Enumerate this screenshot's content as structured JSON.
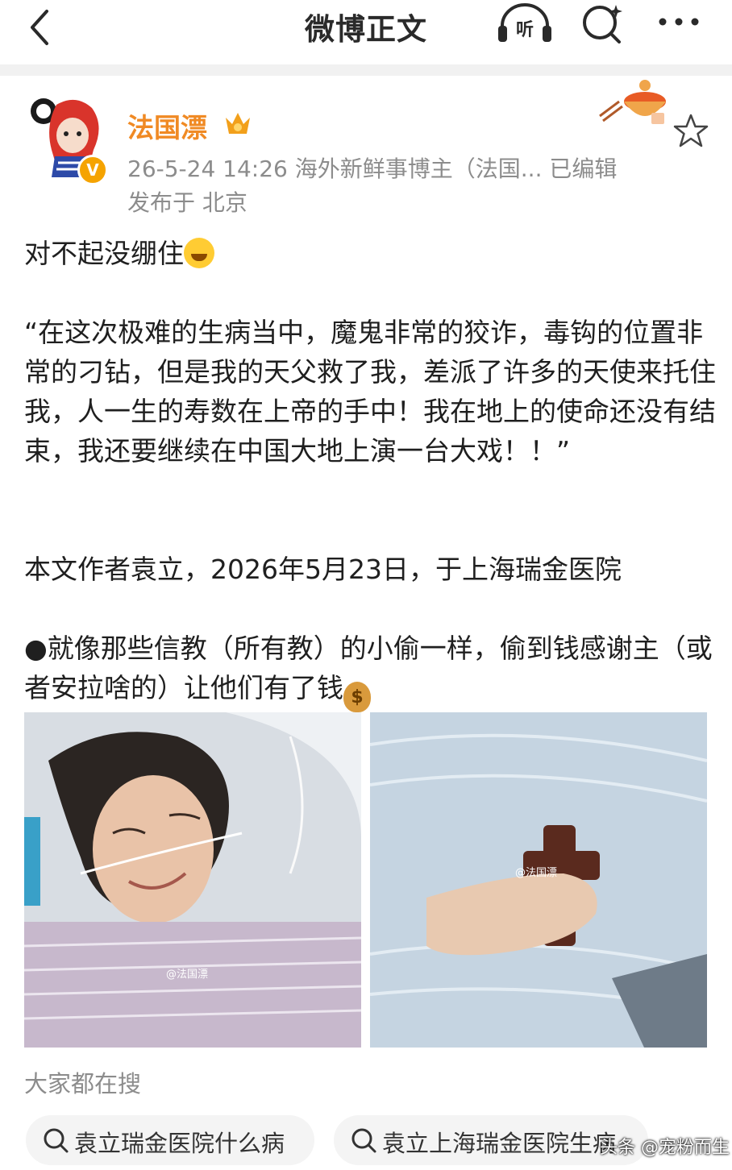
{
  "header": {
    "title": "微博正文",
    "listen_label": "听",
    "icons": [
      "back-chevron-icon",
      "listen-headphones-icon",
      "search-icon",
      "more-dots-icon"
    ]
  },
  "author": {
    "name": "法国漂",
    "verified_badge": "V",
    "meta_line": "26-5-24 14:26  海外新鲜事博主（法国...  已编辑",
    "location_line": "发布于 北京",
    "accent_color": "#f08a24"
  },
  "post": {
    "line1": "对不起没绷住",
    "quote": "“在这次极难的生病当中，魔鬼非常的狡诈，毒钩的位置非常的刁钻，但是我的天父救了我，差派了许多的天使来托住我，人一生的寿数在上帝的手中！我在地上的使命还没有结束，我还要继续在中国大地上演一台大戏！！”",
    "attribution": "本文作者袁立，2026年5月23日，于上海瑞金医院",
    "comment": "●就像那些信教（所有教）的小偷一样，偷到钱感谢主（或者安拉啥的）让他们有了钱",
    "images": [
      {
        "watermark": "@法国漂"
      },
      {
        "watermark": "@法国漂"
      }
    ]
  },
  "search_section": {
    "header": "大家都在搜",
    "chips": [
      {
        "label": "袁立瑞金医院什么病"
      },
      {
        "label": "袁立上海瑞金医院生病"
      }
    ]
  },
  "credit": "头条 @宠粉而生"
}
